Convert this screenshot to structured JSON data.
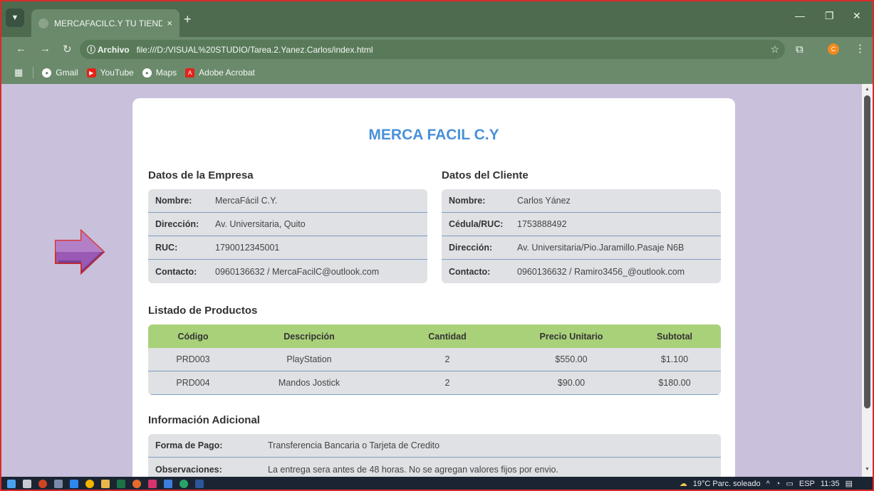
{
  "browser": {
    "tab_title": "MERCAFACILC.Y TU TIENDA DE",
    "tab_close": "×",
    "new_tab": "+",
    "address_badge": "ⓘ Archivo",
    "address_url": "file:///D:/VISUAL%20STUDIO/Tarea.2.Yanez.Carlos/index.html",
    "profile_initial": "C",
    "bookmarks": [
      {
        "label": "Gmail",
        "icon": "globe-icon",
        "color": "#ffffff"
      },
      {
        "label": "YouTube",
        "icon": "youtube-icon",
        "color": "#e62117"
      },
      {
        "label": "Maps",
        "icon": "globe-icon",
        "color": "#ffffff"
      },
      {
        "label": "Adobe Acrobat",
        "icon": "acrobat-icon",
        "color": "#e0241b"
      }
    ]
  },
  "page": {
    "store_name": "MERCA FACIL C.Y",
    "company": {
      "title": "Datos de la Empresa",
      "rows": [
        {
          "key": "Nombre:",
          "value": "MercaFácil C.Y."
        },
        {
          "key": "Dirección:",
          "value": "Av. Universitaria, Quito"
        },
        {
          "key": "RUC:",
          "value": "1790012345001"
        },
        {
          "key": "Contacto:",
          "value": "0960136632 / MercaFacilC@outlook.com"
        }
      ]
    },
    "client": {
      "title": "Datos del Cliente",
      "rows": [
        {
          "key": "Nombre:",
          "value": "Carlos Yánez"
        },
        {
          "key": "Cédula/RUC:",
          "value": "1753888492"
        },
        {
          "key": "Dirección:",
          "value": "Av. Universitaria/Pio.Jaramillo.Pasaje N6B"
        },
        {
          "key": "Contacto:",
          "value": "0960136632 / Ramiro3456_@outlook.com"
        }
      ]
    },
    "products": {
      "title": "Listado de Productos",
      "headers": [
        "Código",
        "Descripción",
        "Cantidad",
        "Precio Unitario",
        "Subtotal"
      ],
      "rows": [
        [
          "PRD003",
          "PlayStation",
          "2",
          "$550.00",
          "$1.100"
        ],
        [
          "PRD004",
          "Mandos Jostick",
          "2",
          "$90.00",
          "$180.00"
        ]
      ]
    },
    "additional": {
      "title": "Información Adicional",
      "rows": [
        {
          "key": "Forma de Pago:",
          "value": "Transferencia Bancaria o Tarjeta de Credito"
        },
        {
          "key": "Observaciones:",
          "value": "La entrega sera antes de 48 horas. No se agregan valores fijos por envio."
        }
      ]
    },
    "colors": {
      "title_blue": "#4a90d9",
      "header_green": "#a9d17a",
      "row_gray": "#dfe1e4",
      "background": "#c9c0dc",
      "arrow_purple": "#8e44ad"
    }
  },
  "taskbar": {
    "weather": "19°C  Parc. soleado",
    "language": "ESP",
    "time": "11:35"
  }
}
